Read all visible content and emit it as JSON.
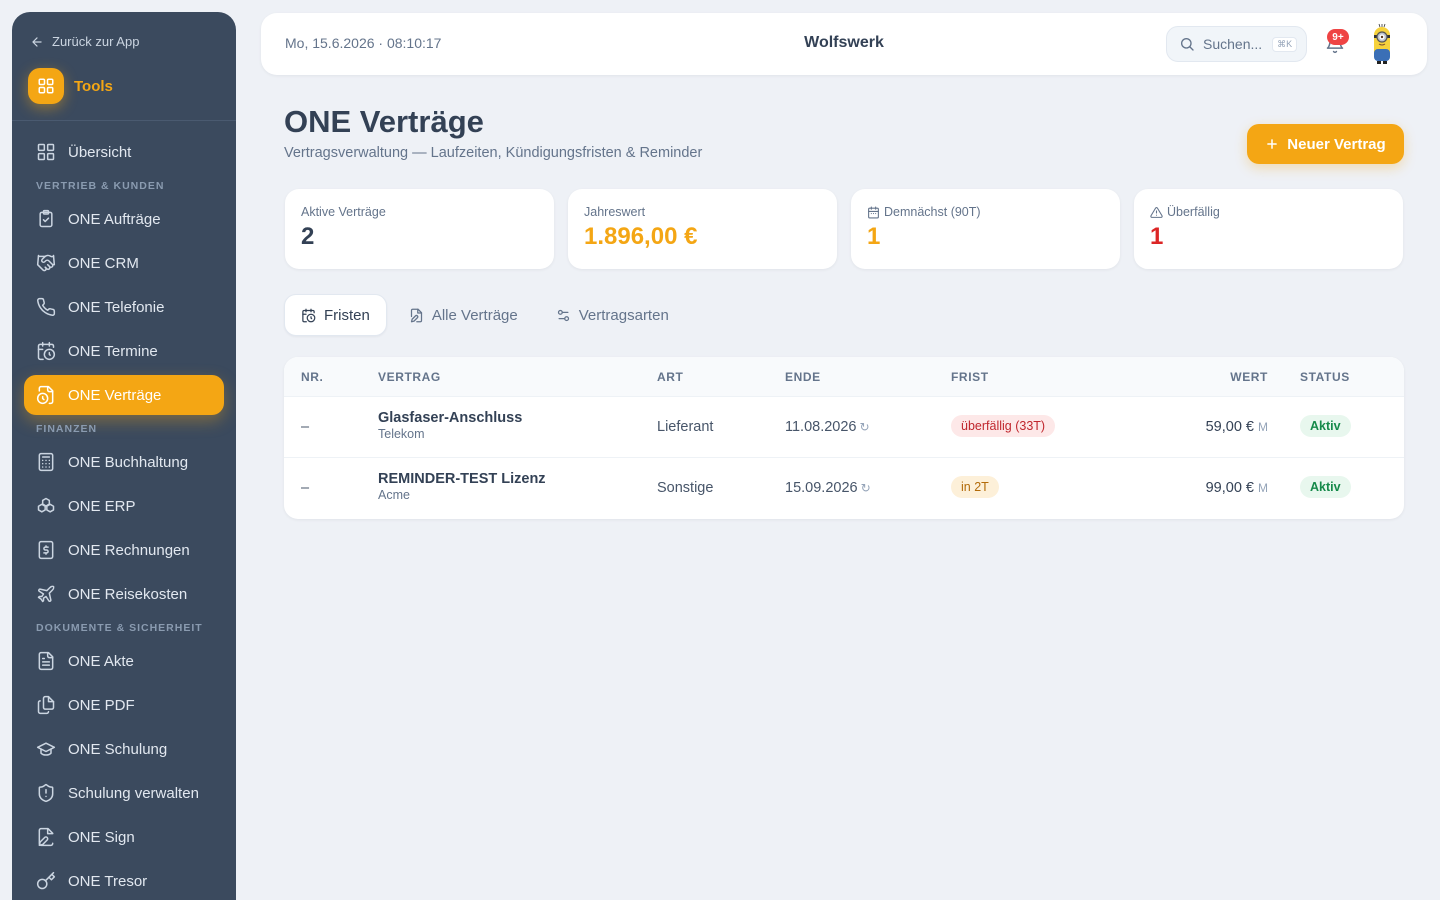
{
  "sidebar": {
    "back_label": "Zurück zur App",
    "tools_label": "Tools",
    "items": [
      {
        "label": "Übersicht",
        "icon": "grid-icon"
      },
      {
        "section": "VERTRIEB & KUNDEN"
      },
      {
        "label": "ONE Aufträge",
        "icon": "clipboard-check-icon"
      },
      {
        "label": "ONE CRM",
        "icon": "handshake-icon"
      },
      {
        "label": "ONE Telefonie",
        "icon": "phone-icon"
      },
      {
        "label": "ONE Termine",
        "icon": "calendar-clock-icon"
      },
      {
        "label": "ONE Verträge",
        "icon": "file-clock-icon",
        "active": true
      },
      {
        "section": "FINANZEN"
      },
      {
        "label": "ONE Buchhaltung",
        "icon": "calculator-icon"
      },
      {
        "label": "ONE ERP",
        "icon": "boxes-icon"
      },
      {
        "label": "ONE Rechnungen",
        "icon": "receipt-dollar-icon"
      },
      {
        "label": "ONE Reisekosten",
        "icon": "plane-icon"
      },
      {
        "section": "DOKUMENTE & SICHERHEIT"
      },
      {
        "label": "ONE Akte",
        "icon": "file-text-icon"
      },
      {
        "label": "ONE PDF",
        "icon": "files-icon"
      },
      {
        "label": "ONE Schulung",
        "icon": "graduation-cap-icon"
      },
      {
        "label": "Schulung verwalten",
        "icon": "shield-icon"
      },
      {
        "label": "ONE Sign",
        "icon": "file-signature-icon"
      },
      {
        "label": "ONE Tresor",
        "icon": "key-icon"
      }
    ]
  },
  "header": {
    "datetime": "Mo, 15.6.2026 · 08:10:17",
    "brand": "Wolfswerk",
    "search_placeholder": "Suchen...",
    "search_shortcut": "⌘K",
    "notification_count": "9+"
  },
  "page": {
    "title": "ONE Verträge",
    "subtitle": "Vertragsverwaltung — Laufzeiten, Kündigungsfristen & Reminder",
    "new_button": "Neuer Vertrag"
  },
  "stats": [
    {
      "label": "Aktive Verträge",
      "value": "2",
      "color": "#334155"
    },
    {
      "label": "Jahreswert",
      "value": "1.896,00 €",
      "color": "#f4a614"
    },
    {
      "label": "Demnächst (90T)",
      "value": "1",
      "color": "#f4a614",
      "icon": "calendar-icon"
    },
    {
      "label": "Überfällig",
      "value": "1",
      "color": "#dc2626",
      "icon": "alert-triangle-icon"
    }
  ],
  "tabs": [
    {
      "label": "Fristen",
      "icon": "calendar-clock-icon",
      "active": true
    },
    {
      "label": "Alle Verträge",
      "icon": "file-edit-icon"
    },
    {
      "label": "Vertragsarten",
      "icon": "settings-sliders-icon"
    }
  ],
  "table": {
    "columns": [
      "NR.",
      "VERTRAG",
      "ART",
      "ENDE",
      "FRIST",
      "WERT",
      "STATUS"
    ],
    "rows": [
      {
        "nr": "–",
        "name": "Glasfaser-Anschluss",
        "partner": "Telekom",
        "art": "Lieferant",
        "ende": "11.08.2026",
        "recur": "↻",
        "frist": "überfällig (33T)",
        "frist_type": "red",
        "wert": "59,00 €",
        "unit": "M",
        "status": "Aktiv"
      },
      {
        "nr": "–",
        "name": "REMINDER-TEST Lizenz",
        "partner": "Acme",
        "art": "Sonstige",
        "ende": "15.09.2026",
        "recur": "↻",
        "frist": "in 2T",
        "frist_type": "amber",
        "wert": "99,00 €",
        "unit": "M",
        "status": "Aktiv"
      }
    ]
  }
}
